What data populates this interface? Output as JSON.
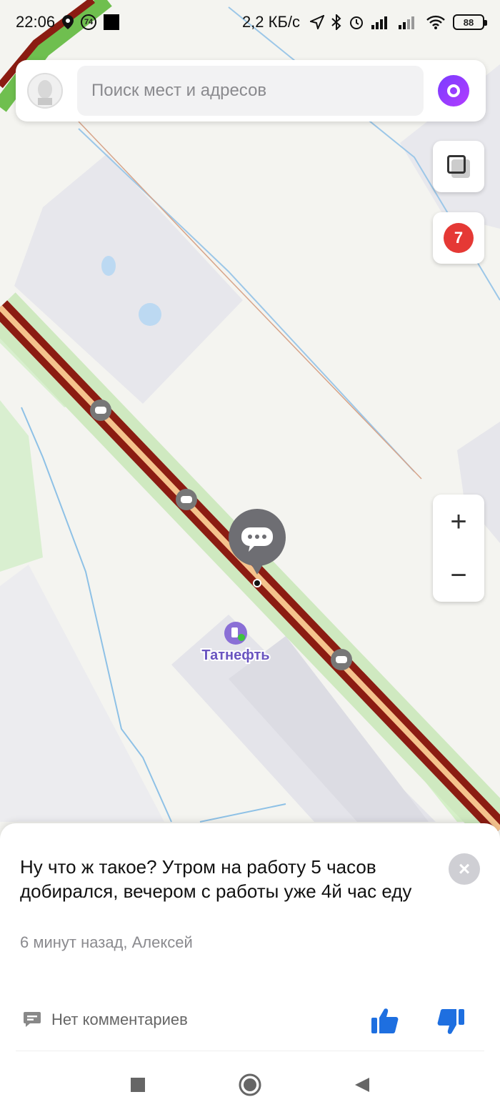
{
  "status_bar": {
    "time": "22:06",
    "speed_badge": "74",
    "network_speed": "2,2 КБ/с",
    "battery": "88"
  },
  "search": {
    "placeholder": "Поиск мест и адресов"
  },
  "map": {
    "traffic_level": "7",
    "poi_label": "Татнефть",
    "icons": [
      "location-pin",
      "navigation-arrow",
      "bluetooth",
      "alarm",
      "signal",
      "wifi",
      "layers",
      "chat-bubble",
      "fuel-station"
    ]
  },
  "zoom": {
    "in": "+",
    "out": "−"
  },
  "event_card": {
    "text": "Ну что ж такое? Утром на работу 5 часов добирался, вечером с работы уже 4й час еду",
    "meta": "6 минут назад, Алексей",
    "comments_label": "Нет комментариев",
    "close_glyph": "×"
  },
  "colors": {
    "accent_blue": "#1e6fe0",
    "traffic_red": "#e53935",
    "jam_dark_red": "#8b1c12",
    "alice_purple": "#8a3cff"
  }
}
